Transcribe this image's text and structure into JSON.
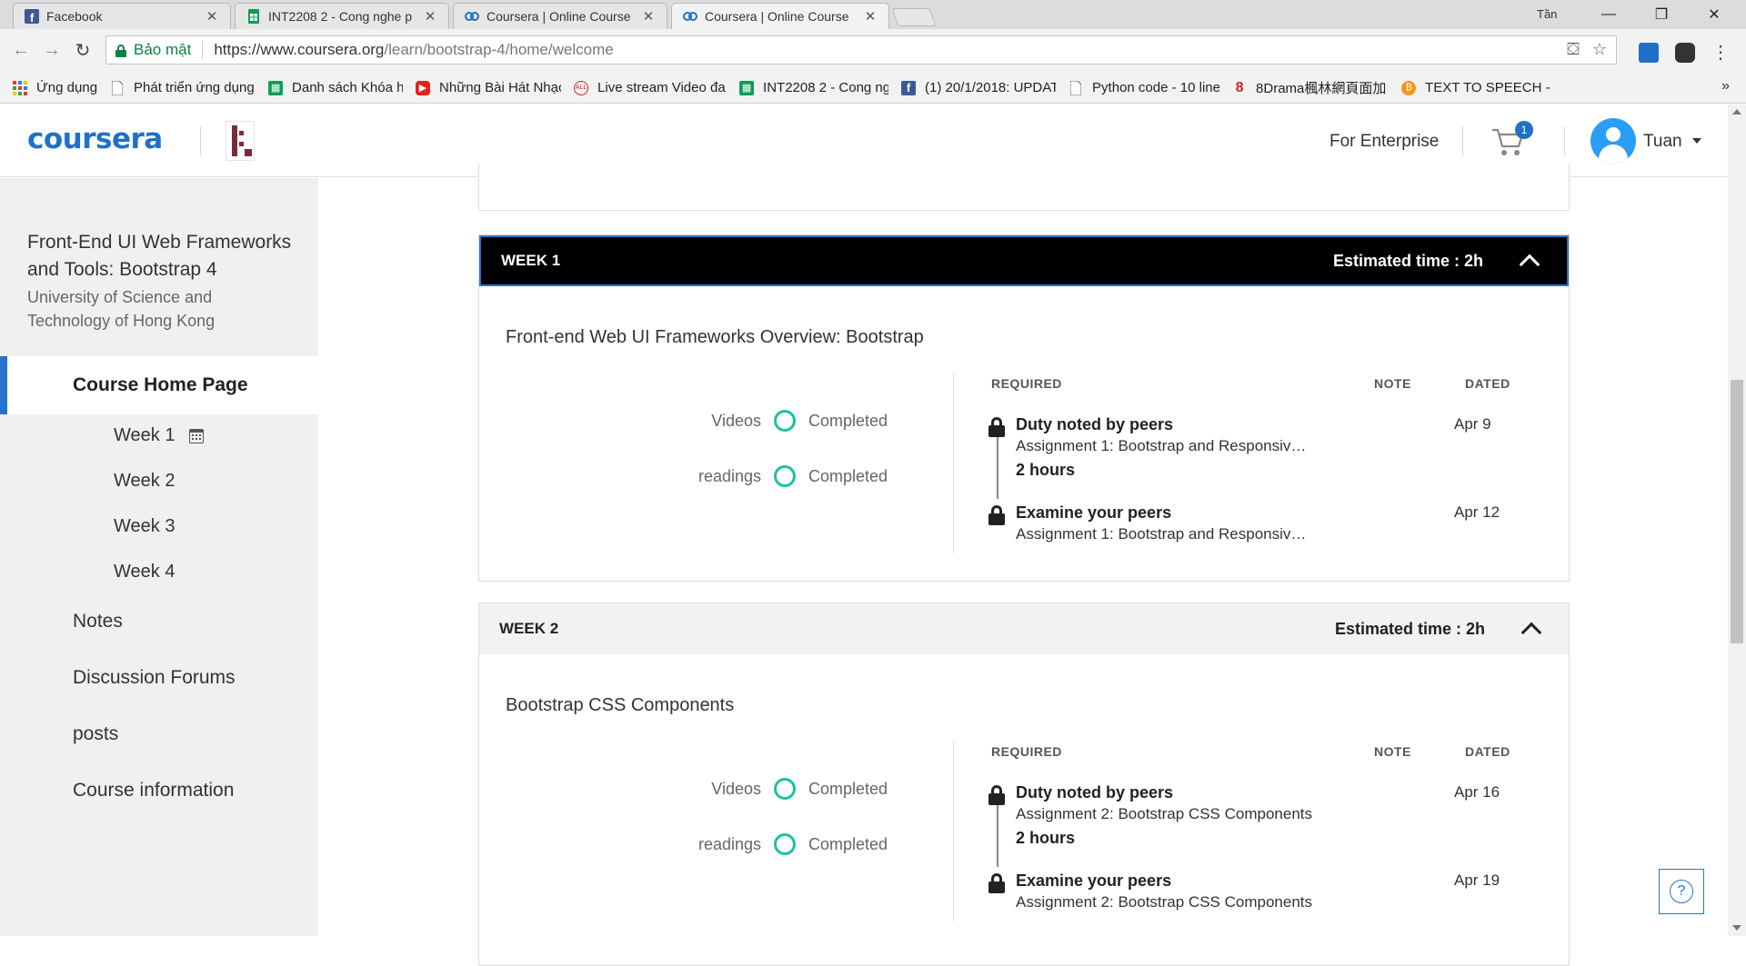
{
  "browser": {
    "tabs": [
      {
        "title": "Facebook",
        "icon": "facebook-icon"
      },
      {
        "title": "INT2208 2 - Cong nghe p",
        "icon": "sheets-icon"
      },
      {
        "title": "Coursera | Online Course",
        "icon": "coursera-icon"
      },
      {
        "title": "Coursera | Online Course",
        "icon": "coursera-icon"
      }
    ],
    "profile_name": "Tần",
    "secure_label": "Bảo mật",
    "url_host": "https://www.coursera.org",
    "url_path": "/learn/bootstrap-4/home/welcome",
    "bookmarks": [
      {
        "label": "Ứng dụng",
        "icon": "apps-grid-icon"
      },
      {
        "label": "Phát triển ứng dụng v",
        "icon": "page-icon"
      },
      {
        "label": "Danh sách Khóa học",
        "icon": "sheets-icon"
      },
      {
        "label": "Những Bài Hát Nhạc",
        "icon": "youtube-icon"
      },
      {
        "label": "Live stream Video đa",
        "icon": "live-icon"
      },
      {
        "label": "INT2208 2 - Cong ng",
        "icon": "sheets-icon"
      },
      {
        "label": "(1) 20/1/2018: UPDAT",
        "icon": "facebook-icon"
      },
      {
        "label": "Python code - 10 line",
        "icon": "page-icon"
      },
      {
        "label": "8Drama楓林網頁面加",
        "icon": "drama-icon"
      },
      {
        "label": "TEXT TO SPEECH - Ch",
        "icon": "bitcoin-icon"
      }
    ],
    "more_label": "»"
  },
  "header": {
    "logo": "coursera",
    "enterprise_label": "For Enterprise",
    "cart_count": "1",
    "user_name": "Tuan"
  },
  "sidebar": {
    "course_title": "Front-End UI Web Frameworks and Tools: Bootstrap 4",
    "university": "University of Science and Technology of Hong Kong",
    "home_label": "Course Home Page",
    "weeks": [
      "Week 1",
      "Week 2",
      "Week 3",
      "Week 4"
    ],
    "links": [
      "Notes",
      "Discussion Forums",
      "posts",
      "Course information"
    ]
  },
  "main": {
    "weeks": [
      {
        "label": "WEEK 1",
        "estimated": "Estimated time : 2h",
        "module": "Front-end Web UI Frameworks Overview: Bootstrap",
        "progress": [
          {
            "label": "Videos",
            "status": "Completed"
          },
          {
            "label": "readings",
            "status": "Completed"
          }
        ],
        "columns": {
          "required": "REQUIRED",
          "note": "NOTE",
          "dated": "DATED"
        },
        "assignments": [
          {
            "title": "Duty noted by peers",
            "subtitle": "Assignment 1: Bootstrap and Responsiv…",
            "hours": "2 hours",
            "date": "Apr 9"
          },
          {
            "title": "Examine your peers",
            "subtitle": "Assignment 1: Bootstrap and Responsiv…",
            "date": "Apr 12"
          }
        ]
      },
      {
        "label": "WEEK 2",
        "estimated": "Estimated time : 2h",
        "module": "Bootstrap CSS Components",
        "progress": [
          {
            "label": "Videos",
            "status": "Completed"
          },
          {
            "label": "readings",
            "status": "Completed"
          }
        ],
        "columns": {
          "required": "REQUIRED",
          "note": "NOTE",
          "dated": "DATED"
        },
        "assignments": [
          {
            "title": "Duty noted by peers",
            "subtitle": "Assignment 2: Bootstrap CSS Components",
            "hours": "2 hours",
            "date": "Apr 16"
          },
          {
            "title": "Examine your peers",
            "subtitle": "Assignment 2: Bootstrap CSS Components",
            "date": "Apr 19"
          }
        ]
      }
    ],
    "help_label": "?"
  },
  "colors": {
    "brand": "#1f71c8",
    "accent": "#2a73cc",
    "completed": "#1cc1a4",
    "sidebar_bg": "#f0f0f0"
  }
}
